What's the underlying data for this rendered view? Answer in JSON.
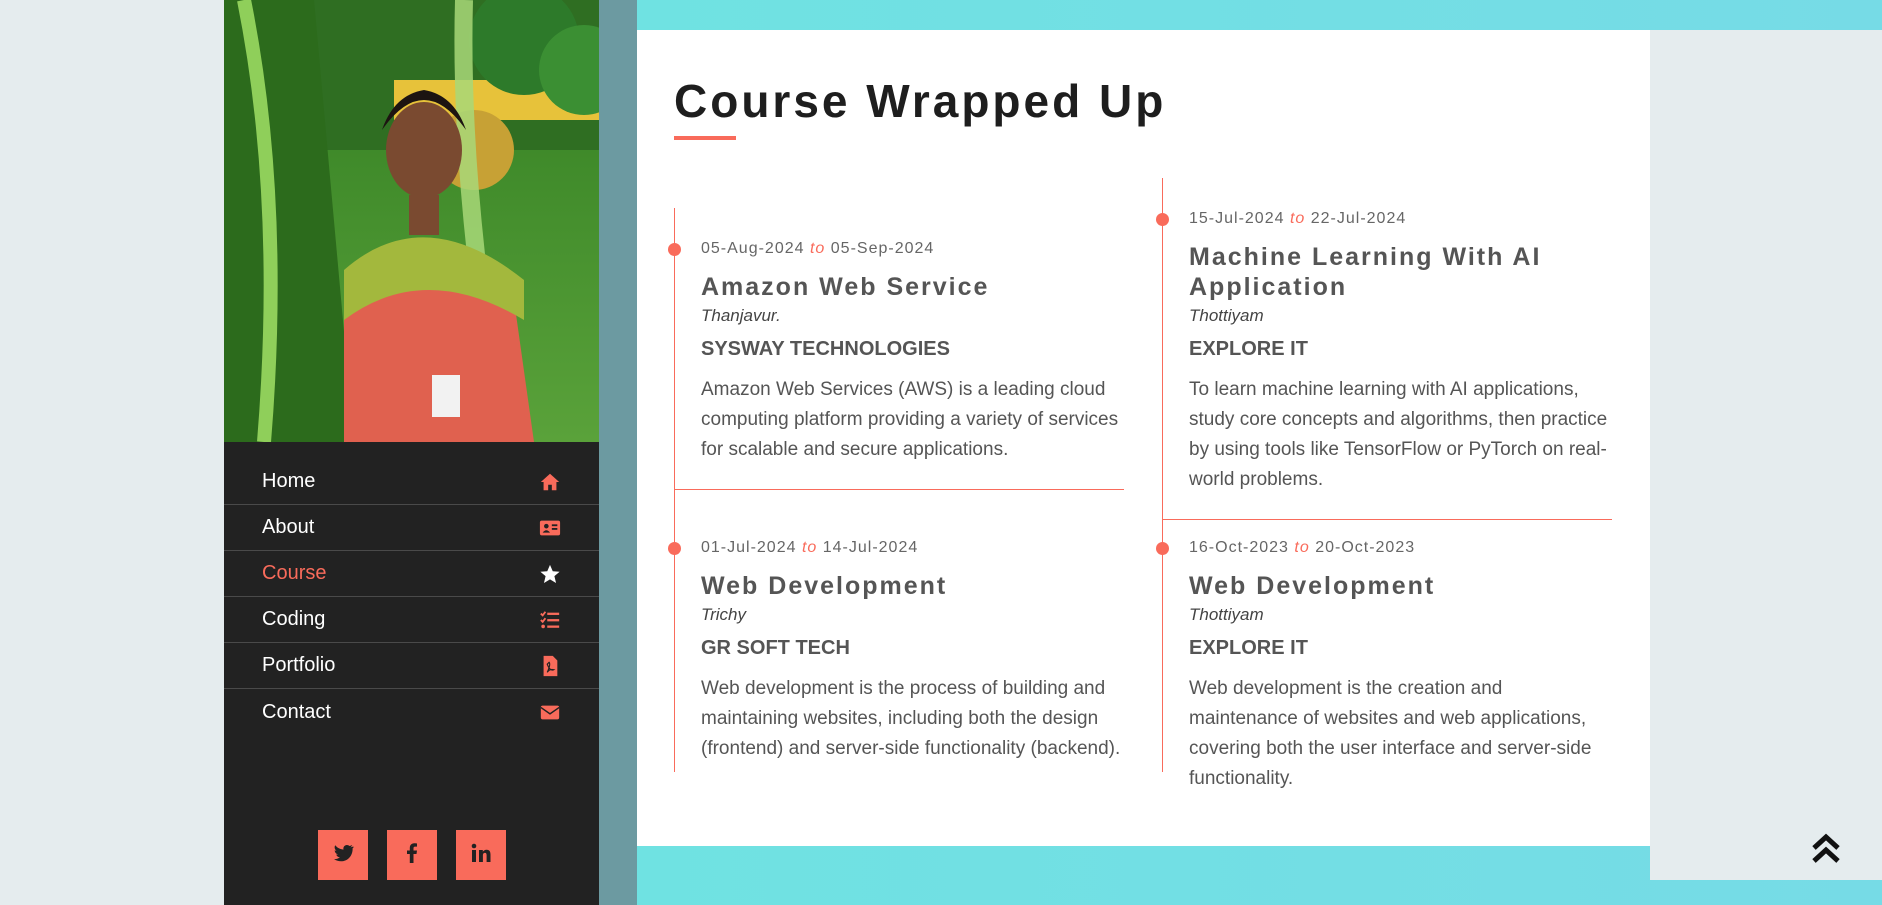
{
  "nav": {
    "items": [
      {
        "label": "Home",
        "icon": "home-icon"
      },
      {
        "label": "About",
        "icon": "id-card-icon"
      },
      {
        "label": "Course",
        "icon": "star-icon",
        "active": true
      },
      {
        "label": "Coding",
        "icon": "list-check-icon"
      },
      {
        "label": "Portfolio",
        "icon": "file-pdf-icon"
      },
      {
        "label": "Contact",
        "icon": "envelope-icon"
      }
    ]
  },
  "socials": [
    "twitter-icon",
    "facebook-icon",
    "linkedin-icon"
  ],
  "page": {
    "title": "Course Wrapped Up"
  },
  "entries": [
    {
      "start": "05-Aug-2024",
      "to": "to",
      "end": "05-Sep-2024",
      "name": "Amazon Web Service",
      "location": "Thanjavur.",
      "company": "SYSWAY TECHNOLOGIES",
      "description": "Amazon Web Services (AWS) is a leading cloud computing platform providing a variety of services for scalable and secure applications."
    },
    {
      "start": "15-Jul-2024",
      "to": "to",
      "end": "22-Jul-2024",
      "name": "Machine Learning With AI Application",
      "location": "Thottiyam",
      "company": "EXPLORE IT",
      "description": "To learn machine learning with AI applications, study core concepts and algorithms, then practice by using tools like TensorFlow or PyTorch on real-world problems."
    },
    {
      "start": "01-Jul-2024",
      "to": "to",
      "end": "14-Jul-2024",
      "name": "Web Development",
      "location": "Trichy",
      "company": "GR SOFT TECH",
      "description": "Web development is the process of building and maintaining websites, including both the design (frontend) and server-side functionality (backend)."
    },
    {
      "start": "16-Oct-2023",
      "to": "to",
      "end": "20-Oct-2023",
      "name": "Web Development",
      "location": "Thottiyam",
      "company": "EXPLORE IT",
      "description": "Web development is the creation and maintenance of websites and web applications, covering both the user interface and server-side functionality."
    }
  ],
  "colors": {
    "accent": "#f96b5b",
    "sidebar": "#222222",
    "teal": "#6fe2e2"
  }
}
